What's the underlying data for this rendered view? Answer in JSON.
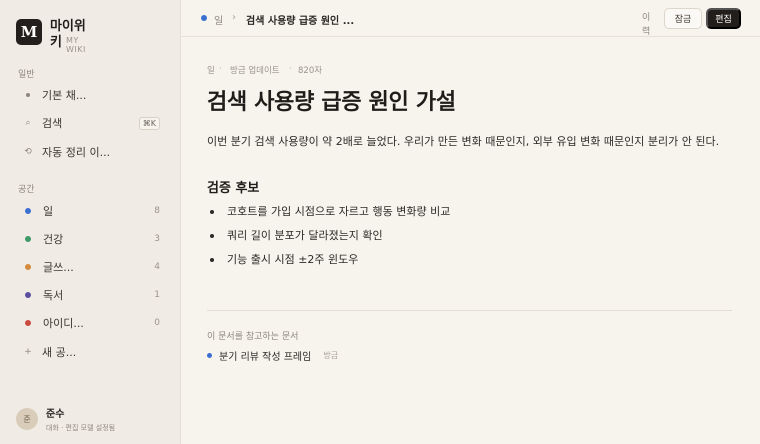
{
  "brand": {
    "logo_letter": "M",
    "name": "마이위키",
    "sub": "MY WIKI"
  },
  "sidebar": {
    "section_general": "일반",
    "general_items": [
      {
        "label": "기본 채...",
        "icon": "dot-icon"
      },
      {
        "label": "검색",
        "icon": "search-icon",
        "shortcut": "⌘K"
      },
      {
        "label": "자동 정리 이...",
        "icon": "auto-organize-icon"
      }
    ],
    "section_spaces": "공간",
    "spaces": [
      {
        "label": "일",
        "count": "8",
        "color": "#3b6fd0"
      },
      {
        "label": "건강",
        "count": "3",
        "color": "#3f9a6a"
      },
      {
        "label": "글쓰...",
        "count": "4",
        "color": "#d48a3a"
      },
      {
        "label": "독서",
        "count": "1",
        "color": "#5a4fa0"
      },
      {
        "label": "아이디...",
        "count": "0",
        "color": "#c94a3f"
      }
    ],
    "new_space": "새 공..."
  },
  "user": {
    "avatar": "준",
    "name": "준수",
    "sub": "대화 · 편집 모델 설정됨"
  },
  "topbar": {
    "crumb_category": "일",
    "crumb_sep": "›",
    "crumb_title": "검색 사용량 급증 원인 ...",
    "history": "이력",
    "lock_label": "잠금",
    "edit_label": "편집"
  },
  "doc": {
    "meta_category": "일",
    "meta_updated": "방금 업데이트",
    "meta_chars": "820자",
    "title": "검색 사용량 급증 원인 가설",
    "paragraph": "이번 분기 검색 사용량이 약 2배로 늘었다. 우리가 만든 변화 때문인지, 외부 유입 변화 때문인지 분리가 안 된다.",
    "heading": "검증 후보",
    "bullets": [
      "코호트를 가입 시점으로 자르고 행동 변화량 비교",
      "쿼리 길이 분포가 달라졌는지 확인",
      "기능 출시 시점 ±2주 윈도우"
    ],
    "backrefs_label": "이 문서를 참고하는 문서",
    "backref": {
      "title": "분기 리뷰 작성 프레임",
      "meta": "방금"
    }
  },
  "colors": {
    "accent_blue": "#3b6fd0",
    "dark_button": "#211e1b"
  }
}
